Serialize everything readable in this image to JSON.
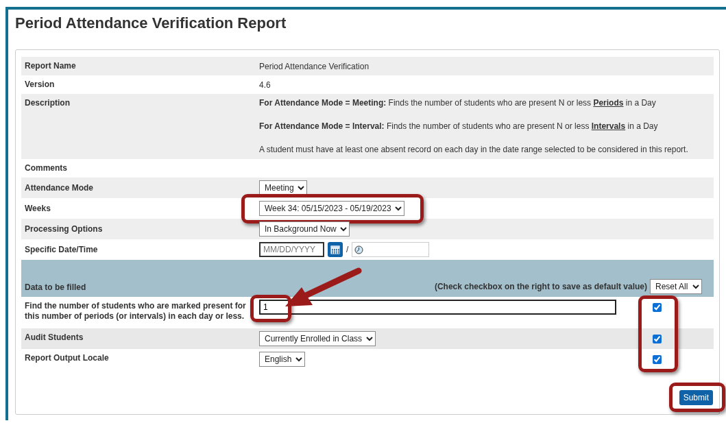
{
  "title": "Period Attendance Verification Report",
  "info_rows": [
    {
      "kind": "text",
      "label": "Report Name",
      "value": "Period Attendance Verification"
    },
    {
      "kind": "text",
      "label": "Version",
      "value": "4.6"
    },
    {
      "kind": "description",
      "label": "Description",
      "paragraphs": [
        {
          "lead": "For Attendance Mode = Meeting:",
          "text": "Finds the number of students who are present N or less",
          "emphasis": "Periods",
          "tail": "in a Day"
        },
        {
          "lead": "For Attendance Mode = Interval:",
          "text": "Finds the number of students who are present N or less",
          "emphasis": "Intervals",
          "tail": "in a Day"
        },
        {
          "text": "A student must have at least one absent record on each day in the date range selected to be considered in this report."
        }
      ]
    },
    {
      "kind": "text",
      "label": "Comments"
    },
    {
      "kind": "select",
      "label": "Attendance Mode",
      "value": "Meeting"
    },
    {
      "kind": "select",
      "label": "Weeks",
      "value": "Week 34: 05/15/2023 - 05/19/2023",
      "highlighted": true
    },
    {
      "kind": "select",
      "label": "Processing Options",
      "value": "In Background Now"
    },
    {
      "kind": "datetime",
      "label": "Specific Date/Time",
      "placeholder": "MM/DD/YYYY",
      "separator": "/"
    }
  ],
  "fill_section": {
    "title": "Data to be filled",
    "hint": "(Check checkbox on the right to save as default value)",
    "reset": "Reset All",
    "checkboxes_highlighted": true
  },
  "fill_rows": [
    {
      "kind": "input",
      "label": "Find the number of students who are marked present for this number of periods (or intervals) in each day or less.",
      "value": "1",
      "checked": true,
      "highlighted": true
    },
    {
      "kind": "select",
      "label": "Audit Students",
      "value": "Currently Enrolled in Class",
      "checked": true
    },
    {
      "kind": "select",
      "label": "Report Output Locale",
      "value": "English",
      "checked": true
    }
  ],
  "submit": {
    "label": "Submit",
    "highlighted": true
  }
}
